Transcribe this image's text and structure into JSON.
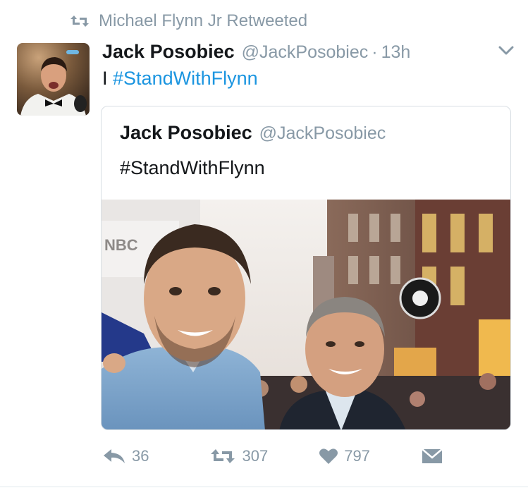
{
  "retweet_context": {
    "text": "Michael Flynn Jr Retweeted",
    "icon": "retweet-icon"
  },
  "tweet": {
    "author_name": "Jack Posobiec",
    "author_handle": "@JackPosobiec",
    "separator": "·",
    "timestamp": "13h",
    "text_prefix": "I",
    "hashtag": "#StandWithFlynn",
    "menu_icon": "chevron-down-icon"
  },
  "quoted_tweet": {
    "author_name": "Jack Posobiec",
    "author_handle": "@JackPosobiec",
    "text": "#StandWithFlynn",
    "photo": {
      "sign_text": "NBC"
    }
  },
  "actions": {
    "reply_count": "36",
    "retweet_count": "307",
    "like_count": "797",
    "icons": [
      "reply-icon",
      "retweet-icon",
      "heart-icon",
      "direct-message-icon"
    ]
  },
  "colors": {
    "link": "#1b95e0",
    "muted": "#8899a6",
    "text": "#14171a",
    "border": "#d8dee3"
  }
}
